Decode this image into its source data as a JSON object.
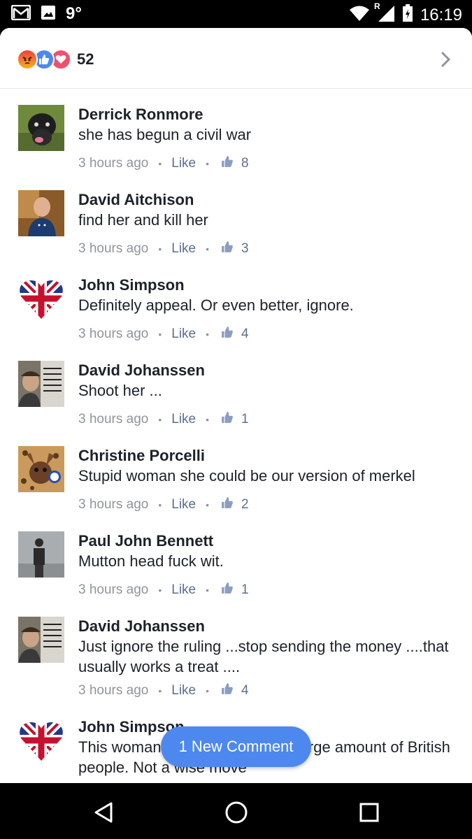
{
  "status_bar": {
    "temperature": "9°",
    "network": "R",
    "time": "16:19"
  },
  "header": {
    "reaction_icons": [
      "angry-reaction-icon",
      "like-reaction-icon",
      "love-reaction-icon"
    ],
    "reaction_count": "52"
  },
  "comments": [
    {
      "name": "Derrick Ronmore",
      "text": "she has begun a civil war",
      "time": "3 hours ago",
      "like_label": "Like",
      "likes": "8"
    },
    {
      "name": "David Aitchison",
      "text": "find her and kill her",
      "time": "3 hours ago",
      "like_label": "Like",
      "likes": "3"
    },
    {
      "name": "John Simpson",
      "text": "Definitely appeal. Or even better, ignore.",
      "time": "3 hours ago",
      "like_label": "Like",
      "likes": "4"
    },
    {
      "name": "David Johanssen",
      "text": "Shoot her ...",
      "time": "3 hours ago",
      "like_label": "Like",
      "likes": "1"
    },
    {
      "name": "Christine Porcelli",
      "text": "Stupid woman she could be our version of merkel",
      "time": "3 hours ago",
      "like_label": "Like",
      "likes": "2"
    },
    {
      "name": "Paul John Bennett",
      "text": "Mutton head fuck wit.",
      "time": "3 hours ago",
      "like_label": "Like",
      "likes": "1"
    },
    {
      "name": "David Johanssen",
      "text": "Just ignore the ruling  ...stop sending the money  ....that usually works a treat  ....",
      "time": "3 hours ago",
      "like_label": "Like",
      "likes": "4"
    },
    {
      "name": "John Simpson",
      "text": "This woman s… against such a large amount of British people. Not a wise move"
    }
  ],
  "new_comment_pill": "1 New Comment",
  "colors": {
    "accent": "#4d88ef",
    "meta_grey": "#90949c",
    "link_blue": "#5b6f8f"
  }
}
